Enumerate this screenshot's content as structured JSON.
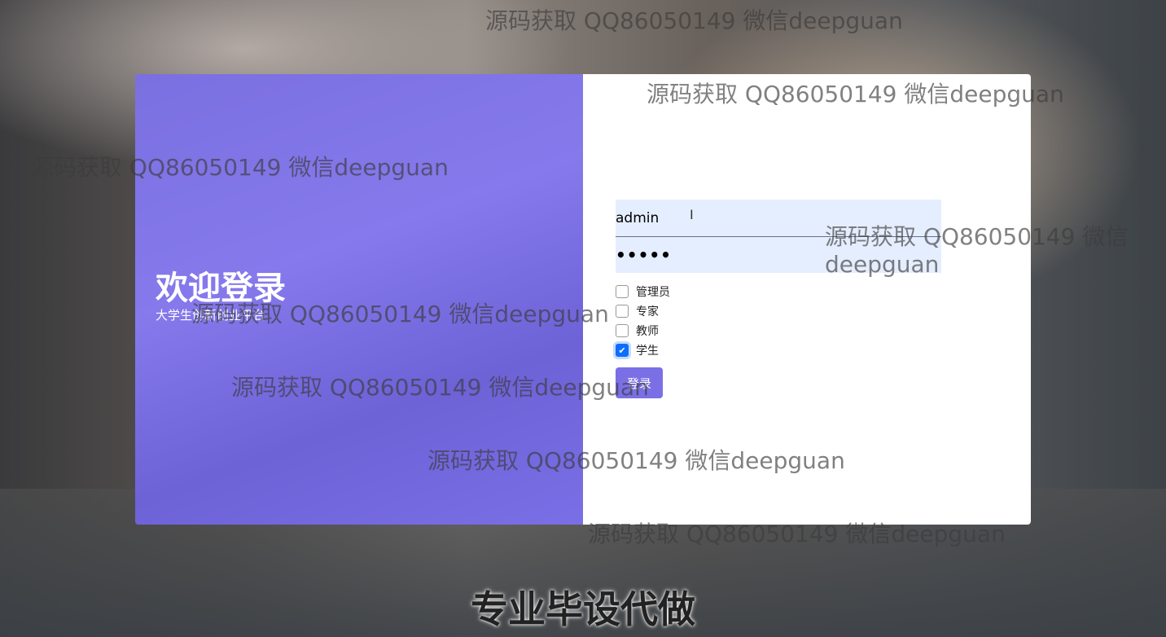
{
  "welcome": {
    "title": "欢迎登录",
    "subtitle": "大学生创新创业平台"
  },
  "form": {
    "username_value": "admin",
    "password_value": "•••••",
    "roles": [
      {
        "label": "管理员",
        "checked": false
      },
      {
        "label": "专家",
        "checked": false
      },
      {
        "label": "教师",
        "checked": false
      },
      {
        "label": "学生",
        "checked": true
      }
    ],
    "login_label": "登录"
  },
  "colors": {
    "accent": "#7b6fe6",
    "checkbox": "#0d6efd",
    "input_bg": "#e5eefe"
  },
  "watermark": "源码获取 QQ86050149 微信deepguan",
  "caption": "专业毕设代做"
}
